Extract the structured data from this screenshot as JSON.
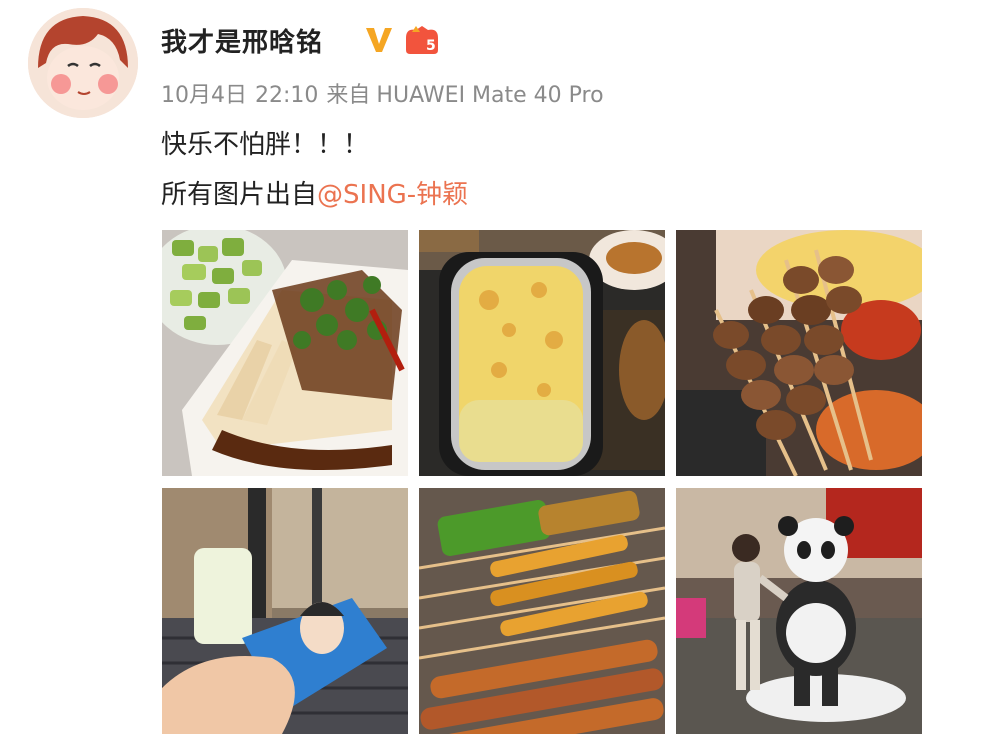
{
  "post": {
    "username": "我才是邢晗铭",
    "level_badge_text": "5",
    "meta": {
      "date": "10月4日",
      "time": "22:10",
      "source_prefix": "来自",
      "device": "HUAWEI Mate 40 Pro"
    },
    "text_line1": "快乐不怕胖！！！",
    "text_line2_prefix": "所有图片出自",
    "mention": "@SING-钟颖",
    "photos": [
      {
        "subject": "tofu-dish"
      },
      {
        "subject": "baked-cheese-tray"
      },
      {
        "subject": "meat-skewers"
      },
      {
        "subject": "ice-cream-popsicle"
      },
      {
        "subject": "grilled-skewers-platter"
      },
      {
        "subject": "panda-statue-photo"
      }
    ]
  },
  "colors": {
    "mention": "#eb7350",
    "verified_badge": "#f5a623",
    "meta_text": "#8a8a8a"
  }
}
